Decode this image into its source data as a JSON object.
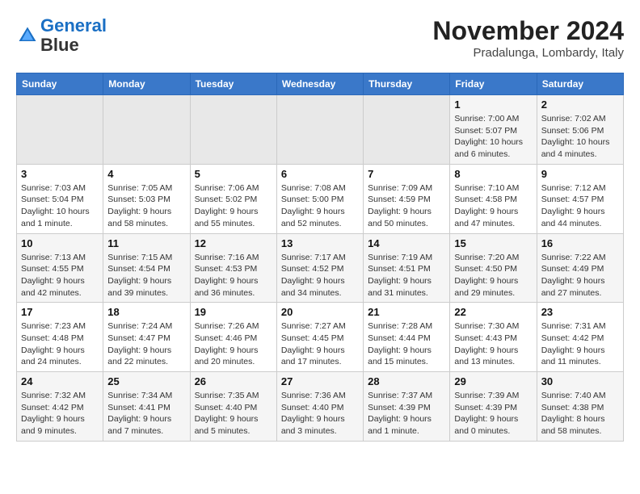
{
  "header": {
    "logo": {
      "line1": "General",
      "line2": "Blue"
    },
    "title": "November 2024",
    "subtitle": "Pradalunga, Lombardy, Italy"
  },
  "weekdays": [
    "Sunday",
    "Monday",
    "Tuesday",
    "Wednesday",
    "Thursday",
    "Friday",
    "Saturday"
  ],
  "weeks": [
    [
      {
        "day": "",
        "info": ""
      },
      {
        "day": "",
        "info": ""
      },
      {
        "day": "",
        "info": ""
      },
      {
        "day": "",
        "info": ""
      },
      {
        "day": "",
        "info": ""
      },
      {
        "day": "1",
        "info": "Sunrise: 7:00 AM\nSunset: 5:07 PM\nDaylight: 10 hours\nand 6 minutes."
      },
      {
        "day": "2",
        "info": "Sunrise: 7:02 AM\nSunset: 5:06 PM\nDaylight: 10 hours\nand 4 minutes."
      }
    ],
    [
      {
        "day": "3",
        "info": "Sunrise: 7:03 AM\nSunset: 5:04 PM\nDaylight: 10 hours\nand 1 minute."
      },
      {
        "day": "4",
        "info": "Sunrise: 7:05 AM\nSunset: 5:03 PM\nDaylight: 9 hours\nand 58 minutes."
      },
      {
        "day": "5",
        "info": "Sunrise: 7:06 AM\nSunset: 5:02 PM\nDaylight: 9 hours\nand 55 minutes."
      },
      {
        "day": "6",
        "info": "Sunrise: 7:08 AM\nSunset: 5:00 PM\nDaylight: 9 hours\nand 52 minutes."
      },
      {
        "day": "7",
        "info": "Sunrise: 7:09 AM\nSunset: 4:59 PM\nDaylight: 9 hours\nand 50 minutes."
      },
      {
        "day": "8",
        "info": "Sunrise: 7:10 AM\nSunset: 4:58 PM\nDaylight: 9 hours\nand 47 minutes."
      },
      {
        "day": "9",
        "info": "Sunrise: 7:12 AM\nSunset: 4:57 PM\nDaylight: 9 hours\nand 44 minutes."
      }
    ],
    [
      {
        "day": "10",
        "info": "Sunrise: 7:13 AM\nSunset: 4:55 PM\nDaylight: 9 hours\nand 42 minutes."
      },
      {
        "day": "11",
        "info": "Sunrise: 7:15 AM\nSunset: 4:54 PM\nDaylight: 9 hours\nand 39 minutes."
      },
      {
        "day": "12",
        "info": "Sunrise: 7:16 AM\nSunset: 4:53 PM\nDaylight: 9 hours\nand 36 minutes."
      },
      {
        "day": "13",
        "info": "Sunrise: 7:17 AM\nSunset: 4:52 PM\nDaylight: 9 hours\nand 34 minutes."
      },
      {
        "day": "14",
        "info": "Sunrise: 7:19 AM\nSunset: 4:51 PM\nDaylight: 9 hours\nand 31 minutes."
      },
      {
        "day": "15",
        "info": "Sunrise: 7:20 AM\nSunset: 4:50 PM\nDaylight: 9 hours\nand 29 minutes."
      },
      {
        "day": "16",
        "info": "Sunrise: 7:22 AM\nSunset: 4:49 PM\nDaylight: 9 hours\nand 27 minutes."
      }
    ],
    [
      {
        "day": "17",
        "info": "Sunrise: 7:23 AM\nSunset: 4:48 PM\nDaylight: 9 hours\nand 24 minutes."
      },
      {
        "day": "18",
        "info": "Sunrise: 7:24 AM\nSunset: 4:47 PM\nDaylight: 9 hours\nand 22 minutes."
      },
      {
        "day": "19",
        "info": "Sunrise: 7:26 AM\nSunset: 4:46 PM\nDaylight: 9 hours\nand 20 minutes."
      },
      {
        "day": "20",
        "info": "Sunrise: 7:27 AM\nSunset: 4:45 PM\nDaylight: 9 hours\nand 17 minutes."
      },
      {
        "day": "21",
        "info": "Sunrise: 7:28 AM\nSunset: 4:44 PM\nDaylight: 9 hours\nand 15 minutes."
      },
      {
        "day": "22",
        "info": "Sunrise: 7:30 AM\nSunset: 4:43 PM\nDaylight: 9 hours\nand 13 minutes."
      },
      {
        "day": "23",
        "info": "Sunrise: 7:31 AM\nSunset: 4:42 PM\nDaylight: 9 hours\nand 11 minutes."
      }
    ],
    [
      {
        "day": "24",
        "info": "Sunrise: 7:32 AM\nSunset: 4:42 PM\nDaylight: 9 hours\nand 9 minutes."
      },
      {
        "day": "25",
        "info": "Sunrise: 7:34 AM\nSunset: 4:41 PM\nDaylight: 9 hours\nand 7 minutes."
      },
      {
        "day": "26",
        "info": "Sunrise: 7:35 AM\nSunset: 4:40 PM\nDaylight: 9 hours\nand 5 minutes."
      },
      {
        "day": "27",
        "info": "Sunrise: 7:36 AM\nSunset: 4:40 PM\nDaylight: 9 hours\nand 3 minutes."
      },
      {
        "day": "28",
        "info": "Sunrise: 7:37 AM\nSunset: 4:39 PM\nDaylight: 9 hours\nand 1 minute."
      },
      {
        "day": "29",
        "info": "Sunrise: 7:39 AM\nSunset: 4:39 PM\nDaylight: 9 hours\nand 0 minutes."
      },
      {
        "day": "30",
        "info": "Sunrise: 7:40 AM\nSunset: 4:38 PM\nDaylight: 8 hours\nand 58 minutes."
      }
    ]
  ]
}
